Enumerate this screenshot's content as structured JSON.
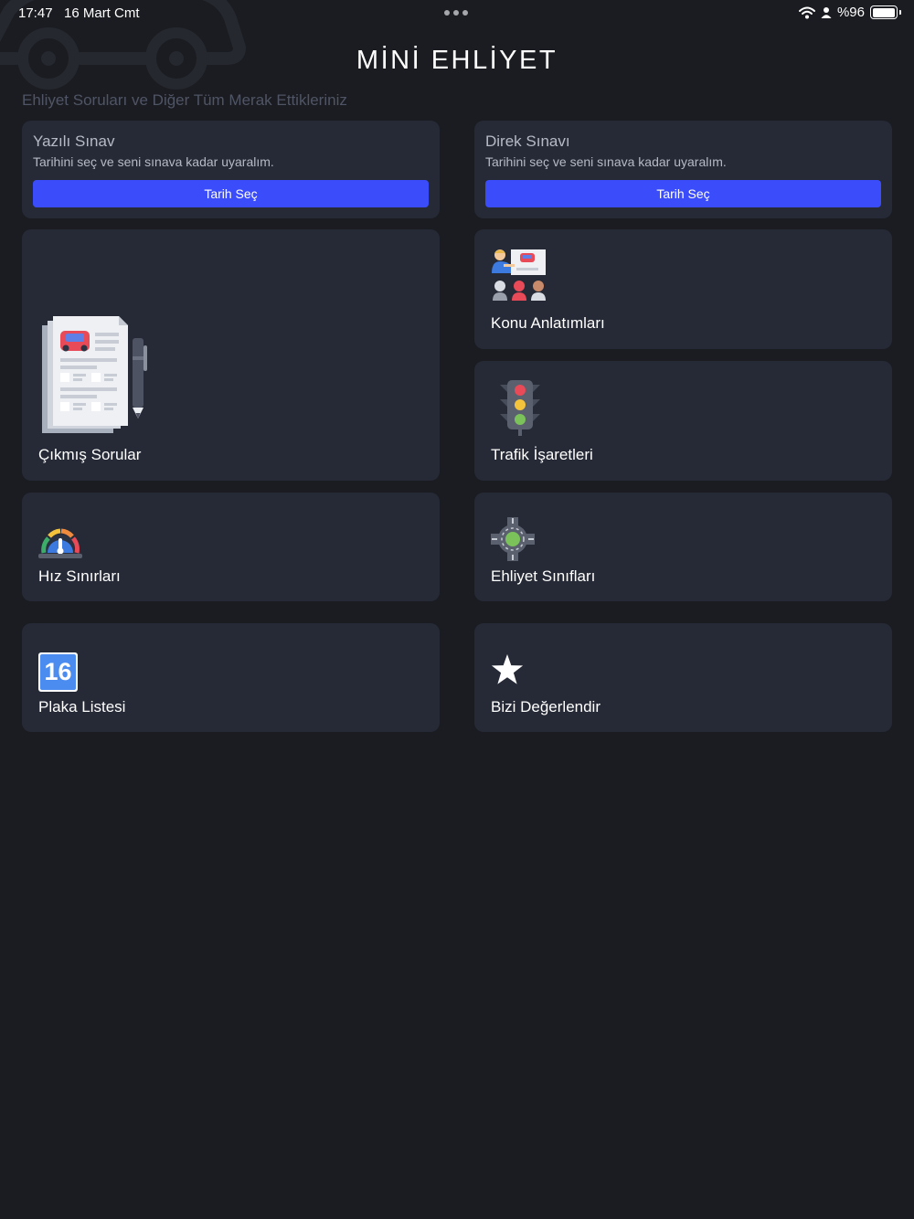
{
  "status_bar": {
    "time": "17:47",
    "date": "16 Mart Cmt",
    "battery": "%96",
    "battery_level": 0.96,
    "icons": [
      "wifi-icon",
      "person-icon",
      "battery-icon"
    ]
  },
  "header": {
    "title": "MİNİ EHLİYET",
    "subtitle": "Ehliyet Soruları ve Diğer Tüm Merak Ettikleriniz"
  },
  "exam_cards": [
    {
      "title": "Yazılı Sınav",
      "description": "Tarihini seç ve seni sınava kadar uyaralım.",
      "button": "Tarih Seç"
    },
    {
      "title": "Direk Sınavı",
      "description": "Tarihini seç ve seni sınava kadar uyaralım.",
      "button": "Tarih Seç"
    }
  ],
  "menu": {
    "past_questions": {
      "label": "Çıkmış Sorular",
      "icon": "exam-papers-icon"
    },
    "lectures": {
      "label": "Konu Anlatımları",
      "icon": "classroom-icon"
    },
    "traffic_signs": {
      "label": "Trafik İşaretleri",
      "icon": "traffic-light-icon"
    },
    "speed_limits": {
      "label": "Hız Sınırları",
      "icon": "speedometer-icon"
    },
    "license_classes": {
      "label": "Ehliyet Sınıfları",
      "icon": "roundabout-icon"
    },
    "plates": {
      "label": "Plaka Listesi",
      "icon": "plate-icon",
      "badge": "16"
    },
    "rate_us": {
      "label": "Bizi Değerlendir",
      "icon": "star-icon"
    }
  },
  "colors": {
    "background": "#1b1c21",
    "card": "#262a36",
    "accent": "#3b4dfb",
    "muted_text": "#b6bac6"
  }
}
